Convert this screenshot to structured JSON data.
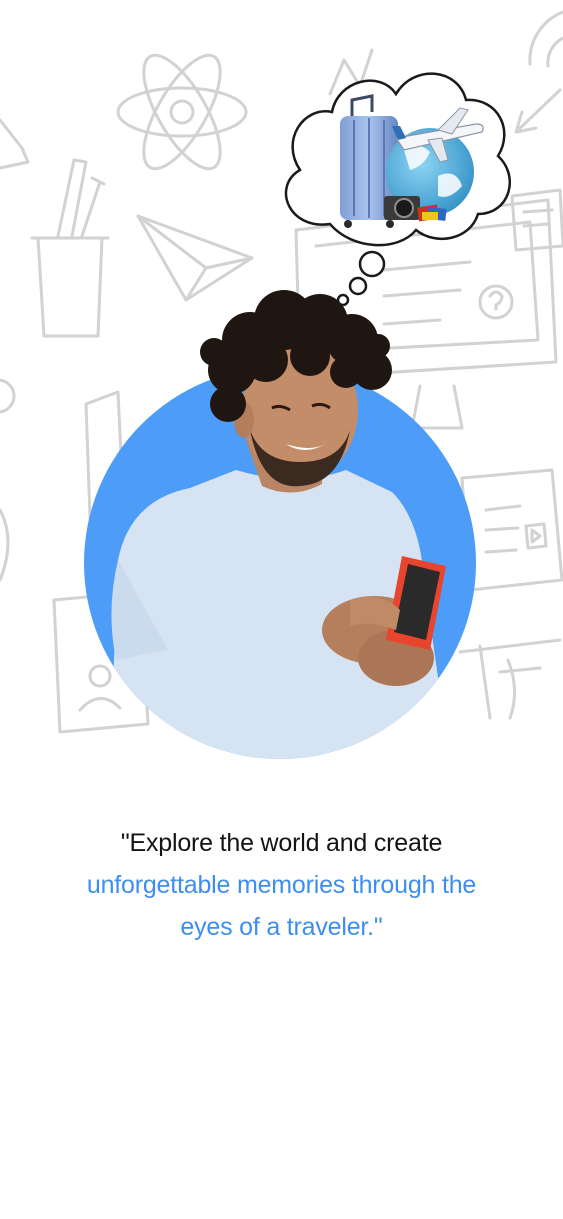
{
  "screen": "onboarding-travel",
  "colors": {
    "accent": "#3d8ef0",
    "circle": "#4d9cf8",
    "text_dark": "#141414",
    "doodle": "#d2d2d2",
    "shirt": "#d6e3f2",
    "phone": "#e8452f"
  },
  "icons": [
    "atom-icon",
    "paper-plane-icon",
    "pencil-cup-icon",
    "monitor-icon",
    "target-icon",
    "book-icon",
    "video-call-icon",
    "suitcase-icon",
    "globe-icon",
    "airplane-icon",
    "camera-icon",
    "passport-icon"
  ],
  "quote": {
    "line1": "\"Explore the world and create",
    "line2": "unforgettable memories through the",
    "line3": "eyes of a traveler.\""
  }
}
